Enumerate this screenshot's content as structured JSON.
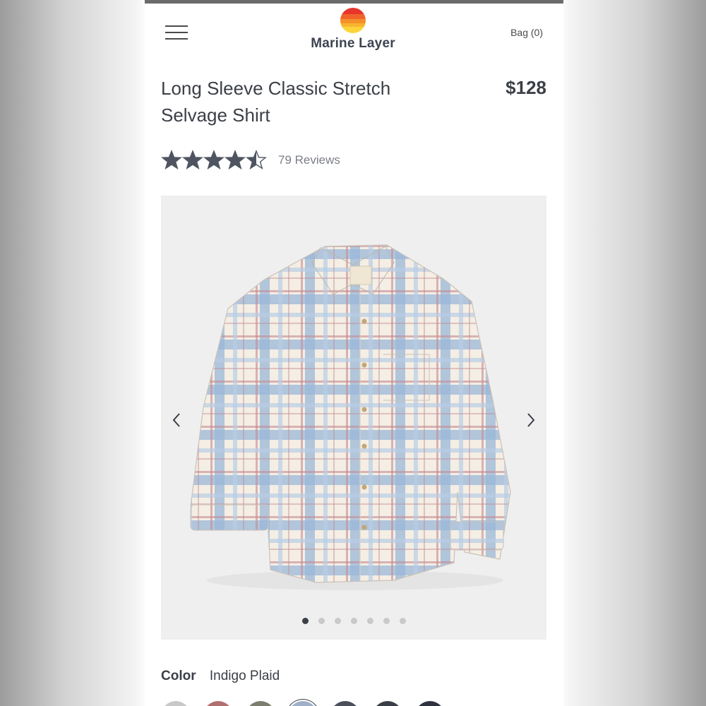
{
  "header": {
    "brand": "Marine Layer",
    "bag_label": "Bag (0)",
    "icons": {
      "menu": "hamburger-menu-icon",
      "logo": "sunset-logo-icon"
    }
  },
  "product": {
    "title": "Long Sleeve Classic Stretch Selvage Shirt",
    "price": "$128",
    "rating": 4.5,
    "rating_max": 5,
    "reviews_label": "79 Reviews"
  },
  "gallery": {
    "image_description": "plaid-shirt-photo",
    "image_count": 7,
    "active_index": 0,
    "prev_icon": "chevron-left-icon",
    "next_icon": "chevron-right-icon"
  },
  "color": {
    "label": "Color",
    "value": "Indigo Plaid",
    "swatches": [
      "#c8c8c8",
      "#b07070",
      "#7d7d6f",
      "#9fb0c8",
      "#4b4f5a",
      "#3a3e47",
      "#2f3340"
    ],
    "selected_index": 3
  },
  "colors": {
    "text_dark": "#3b3f47",
    "text_muted": "#7b7f86",
    "star": "#4f5560"
  }
}
